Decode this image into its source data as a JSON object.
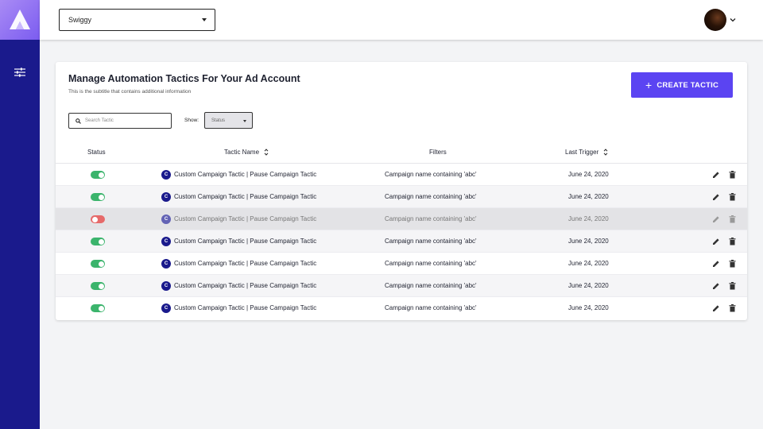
{
  "header": {
    "account_selected": "Swiggy"
  },
  "card": {
    "title": "Manage Automation Tactics For Your Ad Account",
    "subtitle": "This is the subtitle that contains additional information",
    "create_button": "CREATE TACTIC",
    "search_placeholder": "Search Tactic",
    "show_label": "Show:",
    "status_filter": "Status"
  },
  "table": {
    "columns": [
      "Status",
      "Tactic Name",
      "Filters",
      "Last Trigger"
    ],
    "rows": [
      {
        "active": true,
        "badge": "C",
        "name": "Custom Campaign Tactic | Pause Campaign Tactic",
        "filter": "Campaign name containing 'abc'",
        "last_trigger": "June 24, 2020"
      },
      {
        "active": true,
        "badge": "C",
        "name": "Custom Campaign Tactic | Pause Campaign Tactic",
        "filter": "Campaign name containing 'abc'",
        "last_trigger": "June 24, 2020"
      },
      {
        "active": false,
        "badge": "C",
        "name": "Custom Campaign Tactic | Pause Campaign Tactic",
        "filter": "Campaign name containing 'abc'",
        "last_trigger": "June 24, 2020"
      },
      {
        "active": true,
        "badge": "C",
        "name": "Custom Campaign Tactic | Pause Campaign Tactic",
        "filter": "Campaign name containing 'abc'",
        "last_trigger": "June 24, 2020"
      },
      {
        "active": true,
        "badge": "C",
        "name": "Custom Campaign Tactic | Pause Campaign Tactic",
        "filter": "Campaign name containing 'abc'",
        "last_trigger": "June 24, 2020"
      },
      {
        "active": true,
        "badge": "C",
        "name": "Custom Campaign Tactic | Pause Campaign Tactic",
        "filter": "Campaign name containing 'abc'",
        "last_trigger": "June 24, 2020"
      },
      {
        "active": true,
        "badge": "C",
        "name": "Custom Campaign Tactic | Pause Campaign Tactic",
        "filter": "Campaign name containing 'abc'",
        "last_trigger": "June 24, 2020"
      }
    ]
  },
  "colors": {
    "sidebar": "#1a1a8c",
    "accent": "#5b44f2",
    "toggle_on": "#3bb46c",
    "toggle_off": "#e66a6a"
  },
  "icons": [
    "logo-icon",
    "filter-settings-icon",
    "chevron-down-icon",
    "search-icon",
    "sort-icon",
    "edit-icon",
    "trash-icon"
  ]
}
